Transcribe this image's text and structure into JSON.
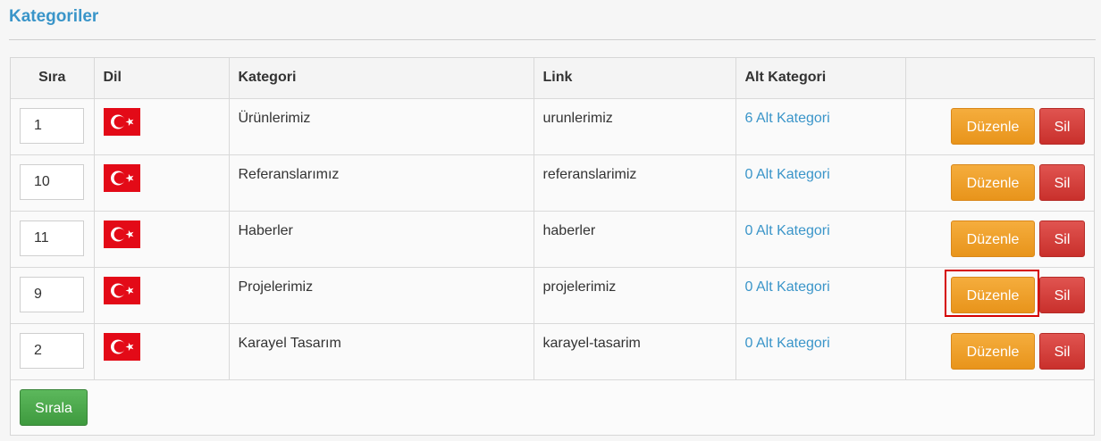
{
  "page_title": "Kategoriler",
  "table": {
    "headers": [
      "Sıra",
      "Dil",
      "Kategori",
      "Link",
      "Alt Kategori",
      ""
    ],
    "rows": [
      {
        "order": "1",
        "flag": "turkey-flag-icon",
        "category": "Ürünlerimiz",
        "link": "urunlerimiz",
        "subcategories": "6 Alt Kategori",
        "edit": "Düzenle",
        "delete": "Sil"
      },
      {
        "order": "10",
        "flag": "turkey-flag-icon",
        "category": "Referanslarımız",
        "link": "referanslarimiz",
        "subcategories": "0 Alt Kategori",
        "edit": "Düzenle",
        "delete": "Sil"
      },
      {
        "order": "11",
        "flag": "turkey-flag-icon",
        "category": "Haberler",
        "link": "haberler",
        "subcategories": "0 Alt Kategori",
        "edit": "Düzenle",
        "delete": "Sil"
      },
      {
        "order": "9",
        "flag": "turkey-flag-icon",
        "category": "Projelerimiz",
        "link": "projelerimiz",
        "subcategories": "0 Alt Kategori",
        "edit": "Düzenle",
        "delete": "Sil",
        "highlighted": true
      },
      {
        "order": "2",
        "flag": "turkey-flag-icon",
        "category": "Karayel Tasarım",
        "link": "karayel-tasarim",
        "subcategories": "0 Alt Kategori",
        "edit": "Düzenle",
        "delete": "Sil"
      }
    ]
  },
  "sort_button": "Sırala",
  "colors": {
    "title": "#3a95c9",
    "link": "#3a95c9",
    "edit_button": "#f0a22e",
    "delete_button": "#d9534f",
    "sort_button": "#4cae4c",
    "highlight": "#d50000"
  }
}
